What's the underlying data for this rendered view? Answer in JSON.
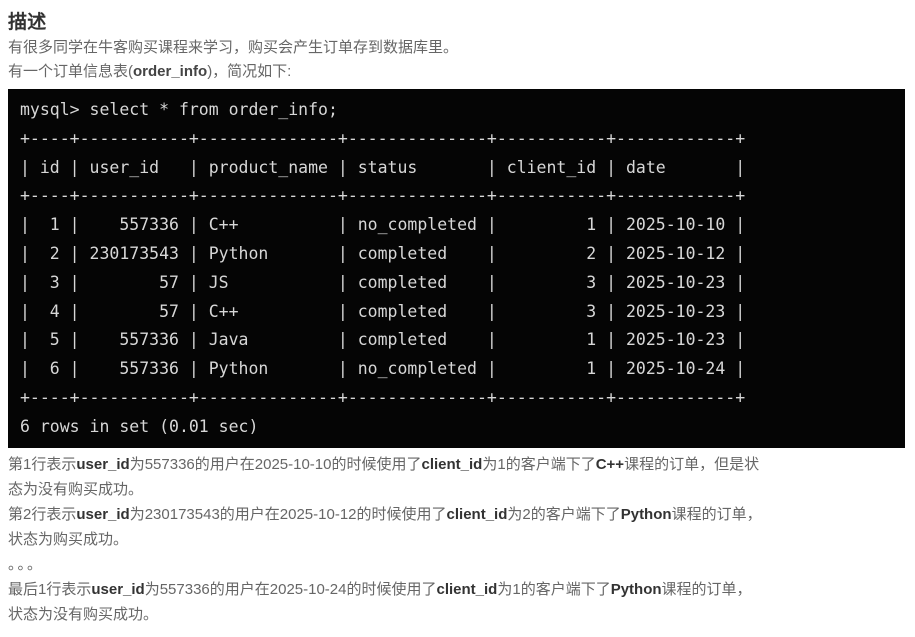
{
  "page": {
    "title": "描述"
  },
  "intro": {
    "line1": "有很多同学在牛客购买课程来学习，购买会产生订单存到数据库里。",
    "line2_prefix": "有一个订单信息表(",
    "line2_table": "order_info",
    "line2_suffix": ")，简况如下:"
  },
  "terminal": {
    "prompt_line": "mysql> select * from order_info;",
    "separator": "+----+-----------+--------------+--------------+-----------+------------+",
    "header_row": "| id | user_id   | product_name | status       | client_id | date       |",
    "rows": [
      "|  1 |    557336 | C++          | no_completed |         1 | 2025-10-10 |",
      "|  2 | 230173543 | Python       | completed    |         2 | 2025-10-12 |",
      "|  3 |        57 | JS           | completed    |         3 | 2025-10-23 |",
      "|  4 |        57 | C++          | completed    |         3 | 2025-10-23 |",
      "|  5 |    557336 | Java         | completed    |         1 | 2025-10-23 |",
      "|  6 |    557336 | Python       | no_completed |         1 | 2025-10-24 |"
    ],
    "footer": "6 rows in set (0.01 sec)",
    "table_name": "order_info",
    "columns": [
      "id",
      "user_id",
      "product_name",
      "status",
      "client_id",
      "date"
    ],
    "data": [
      {
        "id": 1,
        "user_id": 557336,
        "product_name": "C++",
        "status": "no_completed",
        "client_id": 1,
        "date": "2025-10-10"
      },
      {
        "id": 2,
        "user_id": 230173543,
        "product_name": "Python",
        "status": "completed",
        "client_id": 2,
        "date": "2025-10-12"
      },
      {
        "id": 3,
        "user_id": 57,
        "product_name": "JS",
        "status": "completed",
        "client_id": 3,
        "date": "2025-10-23"
      },
      {
        "id": 4,
        "user_id": 57,
        "product_name": "C++",
        "status": "completed",
        "client_id": 3,
        "date": "2025-10-23"
      },
      {
        "id": 5,
        "user_id": 557336,
        "product_name": "Java",
        "status": "completed",
        "client_id": 1,
        "date": "2025-10-23"
      },
      {
        "id": 6,
        "user_id": 557336,
        "product_name": "Python",
        "status": "no_completed",
        "client_id": 1,
        "date": "2025-10-24"
      }
    ],
    "row_count": 6,
    "exec_time": "0.01 sec",
    "bg_color": "#050505",
    "text_color": "#d7d7d7"
  },
  "explain": {
    "p1_l1_a": "第1行表示",
    "p1_l1_b1": "user_id",
    "p1_l1_c": "为557336的用户在2025-10-10的时候使用了",
    "p1_l1_b2": "client_id",
    "p1_l1_d": "为1的客户端下了",
    "p1_l1_b3": "C++",
    "p1_l1_e": "课程的订单，但是状",
    "p1_l2": "态为没有购买成功。",
    "p2_l1_a": "第2行表示",
    "p2_l1_b1": "user_id",
    "p2_l1_c": "为230173543的用户在2025-10-12的时候使用了",
    "p2_l1_b2": "client_id",
    "p2_l1_d": "为2的客户端下了",
    "p2_l1_b3": "Python",
    "p2_l1_e": "课程的订单，",
    "p2_l2": "状态为购买成功。",
    "dots": "。。。",
    "p3_l1_a": "最后1行表示",
    "p3_l1_b1": "user_id",
    "p3_l1_c": "为557336的用户在2025-10-24的时候使用了",
    "p3_l1_b2": "client_id",
    "p3_l1_d": "为1的客户端下了",
    "p3_l1_b3": "Python",
    "p3_l1_e": "课程的订单，",
    "p3_l2": "状态为没有购买成功。"
  }
}
